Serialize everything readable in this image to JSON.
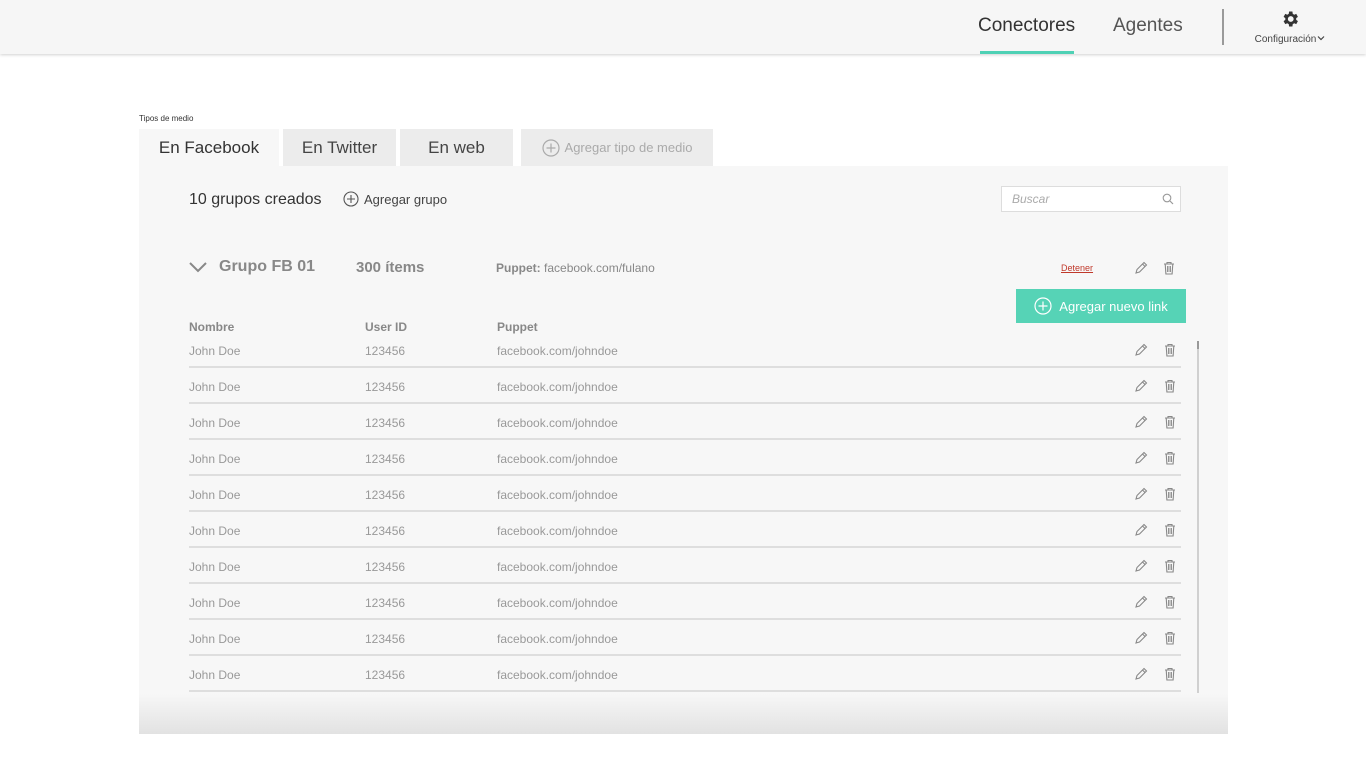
{
  "nav": {
    "conectores": "Conectores",
    "agentes": "Agentes",
    "config_label": "Configuración",
    "accent_color": "#4fd1b5"
  },
  "tabs": {
    "section_label": "Tipos de medio",
    "items": [
      {
        "label": "En Facebook",
        "active": true
      },
      {
        "label": "En Twitter",
        "active": false
      },
      {
        "label": "En web",
        "active": false
      }
    ],
    "add_label": "Agregar tipo de medio"
  },
  "panel": {
    "groups_count": "10 grupos creados",
    "add_group": "Agregar grupo",
    "search_placeholder": "Buscar"
  },
  "group": {
    "name": "Grupo FB 01",
    "items_count": "300 ítems",
    "puppet_label": "Puppet:",
    "puppet_value": "facebook.com/fulano",
    "stop_label": "Detener",
    "add_link_label": "Agregar nuevo link",
    "add_link_color": "#56d3b6"
  },
  "table": {
    "headers": {
      "nombre": "Nombre",
      "user_id": "User ID",
      "puppet": "Puppet"
    },
    "rows": [
      {
        "nombre": "John Doe",
        "user_id": "123456",
        "puppet": "facebook.com/johndoe"
      },
      {
        "nombre": "John Doe",
        "user_id": "123456",
        "puppet": "facebook.com/johndoe"
      },
      {
        "nombre": "John Doe",
        "user_id": "123456",
        "puppet": "facebook.com/johndoe"
      },
      {
        "nombre": "John Doe",
        "user_id": "123456",
        "puppet": "facebook.com/johndoe"
      },
      {
        "nombre": "John Doe",
        "user_id": "123456",
        "puppet": "facebook.com/johndoe"
      },
      {
        "nombre": "John Doe",
        "user_id": "123456",
        "puppet": "facebook.com/johndoe"
      },
      {
        "nombre": "John Doe",
        "user_id": "123456",
        "puppet": "facebook.com/johndoe"
      },
      {
        "nombre": "John Doe",
        "user_id": "123456",
        "puppet": "facebook.com/johndoe"
      },
      {
        "nombre": "John Doe",
        "user_id": "123456",
        "puppet": "facebook.com/johndoe"
      },
      {
        "nombre": "John Doe",
        "user_id": "123456",
        "puppet": "facebook.com/johndoe"
      }
    ]
  },
  "icons": {
    "gear": "gear-icon",
    "chevron": "chevron-down-icon",
    "plus_circle": "plus-circle-icon",
    "search": "search-icon",
    "pencil": "pencil-icon",
    "trash": "trash-icon"
  }
}
